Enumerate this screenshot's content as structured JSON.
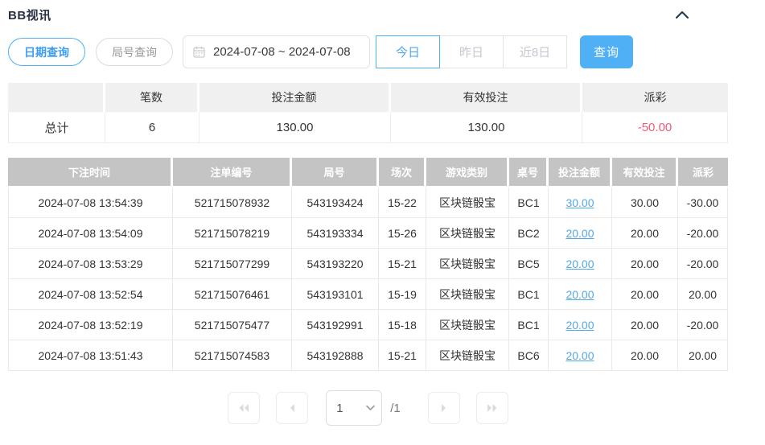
{
  "header": {
    "title": "BB视讯"
  },
  "filters": {
    "date_query_label": "日期查询",
    "round_query_label": "局号查询",
    "date_range_value": "2024-07-08 ~ 2024-07-08",
    "quick_buttons": {
      "today": "今日",
      "yesterday": "昨日",
      "last8days": "近8日"
    },
    "search_label": "查询"
  },
  "summary": {
    "headers": [
      "",
      "笔数",
      "投注金额",
      "有效投注",
      "派彩"
    ],
    "total": {
      "label": "总计",
      "count": "6",
      "bet_amount": "130.00",
      "valid_bet": "130.00",
      "payout": "-50.00"
    }
  },
  "table": {
    "headers": [
      "下注时间",
      "注单编号",
      "局号",
      "场次",
      "游戏类别",
      "桌号",
      "投注金额",
      "有效投注",
      "派彩"
    ],
    "rows": [
      {
        "time": "2024-07-08 13:54:39",
        "order_no": "521715078932",
        "round_no": "543193424",
        "session": "15-22",
        "game_type": "区块链骰宝",
        "table_no": "BC1",
        "bet_amount": "30.00",
        "valid_bet": "30.00",
        "payout": "-30.00"
      },
      {
        "time": "2024-07-08 13:54:09",
        "order_no": "521715078219",
        "round_no": "543193334",
        "session": "15-26",
        "game_type": "区块链骰宝",
        "table_no": "BC2",
        "bet_amount": "20.00",
        "valid_bet": "20.00",
        "payout": "-20.00"
      },
      {
        "time": "2024-07-08 13:53:29",
        "order_no": "521715077299",
        "round_no": "543193220",
        "session": "15-21",
        "game_type": "区块链骰宝",
        "table_no": "BC5",
        "bet_amount": "20.00",
        "valid_bet": "20.00",
        "payout": "-20.00"
      },
      {
        "time": "2024-07-08 13:52:54",
        "order_no": "521715076461",
        "round_no": "543193101",
        "session": "15-19",
        "game_type": "区块链骰宝",
        "table_no": "BC1",
        "bet_amount": "20.00",
        "valid_bet": "20.00",
        "payout": "20.00"
      },
      {
        "time": "2024-07-08 13:52:19",
        "order_no": "521715075477",
        "round_no": "543192991",
        "session": "15-18",
        "game_type": "区块链骰宝",
        "table_no": "BC1",
        "bet_amount": "20.00",
        "valid_bet": "20.00",
        "payout": "-20.00"
      },
      {
        "time": "2024-07-08 13:51:43",
        "order_no": "521715074583",
        "round_no": "543192888",
        "session": "15-21",
        "game_type": "区块链骰宝",
        "table_no": "BC6",
        "bet_amount": "20.00",
        "valid_bet": "20.00",
        "payout": "20.00"
      }
    ]
  },
  "pagination": {
    "page_value": "1",
    "total_label": "/1"
  },
  "icons": {
    "collapse": "chevron-up",
    "calendar": "calendar",
    "first_page": "double-chevron-left",
    "prev_page": "chevron-left",
    "next_page": "chevron-right",
    "last_page": "double-chevron-right",
    "select_caret": "chevron-down"
  },
  "colors": {
    "accent_blue": "#4fb0f5",
    "link_blue": "#53a8e8",
    "negative_red": "#f25b74",
    "table_header_gray": "#c4c4c4",
    "summary_header_gray": "#f0f0f0"
  }
}
